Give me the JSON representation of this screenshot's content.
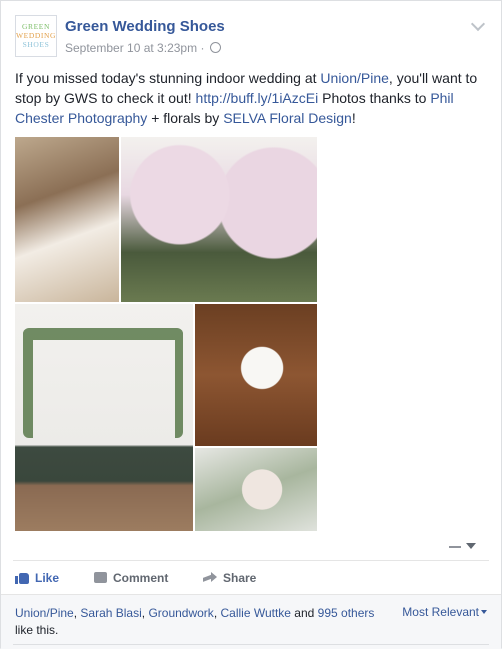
{
  "post": {
    "logo_lines": [
      "GREEN",
      "WEDDING",
      "SHOES"
    ],
    "page_name": "Green Wedding Shoes",
    "date": "September 10 at 3:23pm",
    "dot": "·",
    "text": {
      "t1": "If you missed today's stunning indoor wedding at ",
      "link1": "Union/Pine",
      "t2": ", you'll want to stop by GWS to check it out! ",
      "link2": "http://buff.ly/1iAzcEi",
      "t3": " Photos thanks to ",
      "link3": "Phil Chester Photography",
      "t4": " + florals by ",
      "link4": "SELVA Floral Design",
      "t5": "!"
    }
  },
  "actions": {
    "like": "Like",
    "comment": "Comment",
    "share": "Share"
  },
  "footer": {
    "liker1": "Union/Pine",
    "sep1": ", ",
    "liker2": "Sarah Blasi",
    "sep2": ", ",
    "liker3": "Groundwork",
    "sep3": ", ",
    "liker4": "Callie Wuttke",
    "and": " and ",
    "others": "995 others",
    "like_this": "like this.",
    "sort_label": "Most Relevant"
  },
  "colors": {
    "link": "#365899",
    "like_blue": "#4267b2",
    "muted": "#90949c"
  }
}
